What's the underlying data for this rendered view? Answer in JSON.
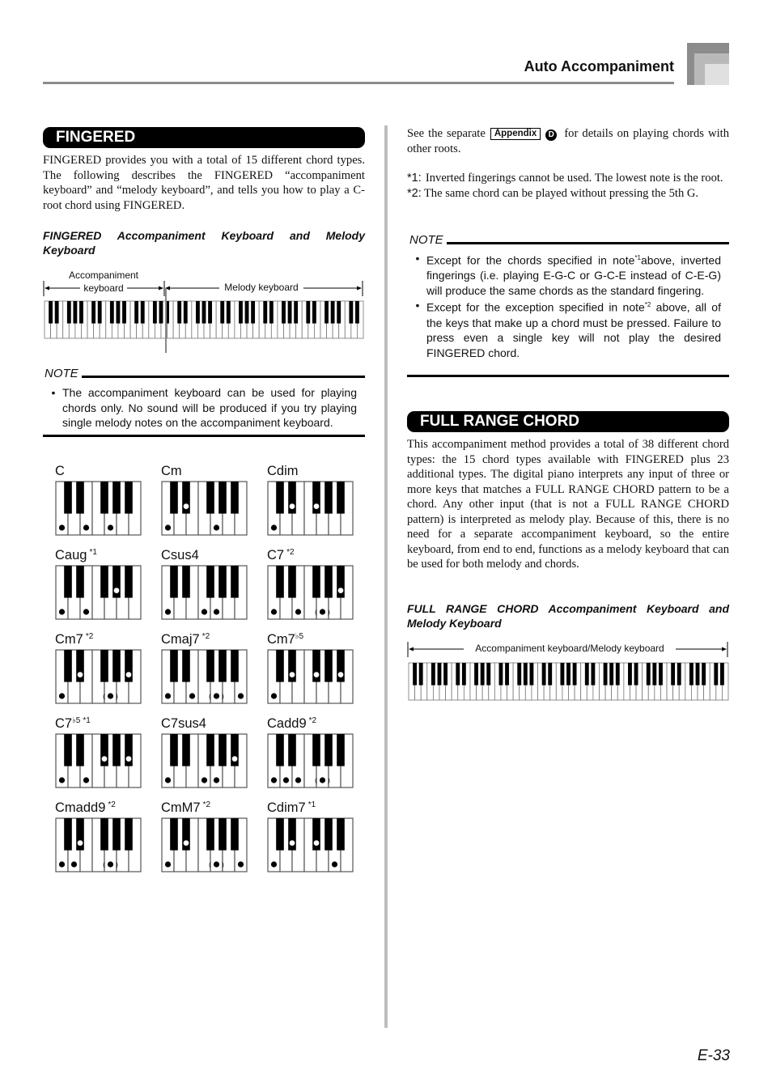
{
  "header": {
    "title": "Auto Accompaniment"
  },
  "page_number": "E-33",
  "fingered": {
    "heading": "FINGERED",
    "intro": "FINGERED provides you with a total of 15 different chord types. The following describes the FINGERED “accompaniment keyboard” and “melody keyboard”, and tells you how to play a C-root chord using FINGERED.",
    "subheading": "FINGERED Accompaniment Keyboard and Melody Keyboard",
    "keyboard_labels": {
      "accompaniment_line1": "Accompaniment",
      "accompaniment_line2": "keyboard",
      "melody": "Melody keyboard"
    },
    "note": {
      "label": "NOTE",
      "items": [
        "The accompaniment keyboard can be used for playing chords only. No sound will be produced if you try playing single melody notes on the accompaniment keyboard."
      ]
    },
    "chords": [
      {
        "name": "C",
        "sup": "",
        "flat5": false,
        "white": [
          0,
          2,
          4
        ],
        "black": [],
        "optional": []
      },
      {
        "name": "Cm",
        "sup": "",
        "flat5": false,
        "white": [
          0,
          4
        ],
        "black": [
          1
        ],
        "optional": []
      },
      {
        "name": "Cdim",
        "sup": "",
        "flat5": false,
        "white": [
          0
        ],
        "black": [
          1,
          2
        ],
        "optional": []
      },
      {
        "name": "Caug",
        "sup": "*1",
        "flat5": false,
        "white": [
          0,
          2
        ],
        "black": [
          3
        ],
        "optional": []
      },
      {
        "name": "Csus4",
        "sup": "",
        "flat5": false,
        "white": [
          0,
          3,
          4
        ],
        "black": [],
        "optional": []
      },
      {
        "name": "C7",
        "sup": "*2",
        "flat5": false,
        "white": [
          0,
          2
        ],
        "black": [
          4
        ],
        "optional": [
          4
        ]
      },
      {
        "name": "Cm7",
        "sup": "*2",
        "flat5": false,
        "white": [
          0
        ],
        "black": [
          1,
          4
        ],
        "optional": [
          4
        ]
      },
      {
        "name": "Cmaj7",
        "sup": "*2",
        "flat5": false,
        "white": [
          0,
          2,
          6
        ],
        "black": [],
        "optional": [
          4
        ]
      },
      {
        "name": "Cm7",
        "sup": "",
        "flat5": true,
        "white": [
          0
        ],
        "black": [
          1,
          2,
          4
        ],
        "optional": []
      },
      {
        "name": "C7",
        "sup": "*1",
        "flat5": true,
        "white": [
          0,
          2
        ],
        "black": [
          2,
          4
        ],
        "optional": []
      },
      {
        "name": "C7sus4",
        "sup": "",
        "flat5": false,
        "white": [
          0,
          3,
          4
        ],
        "black": [
          4
        ],
        "optional": []
      },
      {
        "name": "Cadd9",
        "sup": "*2",
        "flat5": false,
        "white": [
          0,
          1,
          2
        ],
        "black": [],
        "optional": [
          4
        ]
      },
      {
        "name": "Cmadd9",
        "sup": "*2",
        "flat5": false,
        "white": [
          0,
          1
        ],
        "black": [
          1
        ],
        "optional": [
          4
        ]
      },
      {
        "name": "CmM7",
        "sup": "*2",
        "flat5": false,
        "white": [
          0,
          6
        ],
        "black": [
          1
        ],
        "optional": [
          4
        ]
      },
      {
        "name": "Cdim7",
        "sup": "*1",
        "flat5": false,
        "white": [
          0,
          5
        ],
        "black": [
          1,
          2
        ],
        "optional": []
      }
    ]
  },
  "right": {
    "see_prefix": "See the separate",
    "appendix_label": "Appendix",
    "appendix_letter": "D",
    "see_suffix": "for details on playing chords with other roots.",
    "footnotes": [
      {
        "key": "*1:",
        "text": "Inverted fingerings cannot be used. The lowest note is the root."
      },
      {
        "key": "*2:",
        "text": "The same chord can be played without pressing the 5th G."
      }
    ],
    "note": {
      "label": "NOTE",
      "item1_a": "Except for the chords specified in note",
      "item1_sup": "*1",
      "item1_b": "above, inverted fingerings (i.e. playing E-G-C or G-C-E instead of C-E-G) will produce the same chords as the standard fingering.",
      "item2_a": "Except for the exception specified in note",
      "item2_sup": "*2",
      "item2_b": " above, all of the keys that make up a chord must be pressed. Failure to press even a single key will not play the desired FINGERED chord."
    }
  },
  "full_range": {
    "heading": "FULL RANGE CHORD",
    "body": "This accompaniment method provides a total of 38 different chord types: the 15 chord types available with FINGERED plus 23 additional types. The digital piano interprets any input of three or more keys that matches a FULL RANGE CHORD pattern to be a chord. Any other input (that is not a FULL RANGE CHORD pattern) is interpreted as melody play. Because of this, there is no need for a separate accompaniment keyboard, so the entire keyboard, from end to end, functions as a melody keyboard that can be used for both melody and chords.",
    "subheading": "FULL RANGE CHORD Accompaniment Keyboard and Melody Keyboard",
    "keyboard_label": "Accompaniment keyboard/Melody keyboard"
  }
}
